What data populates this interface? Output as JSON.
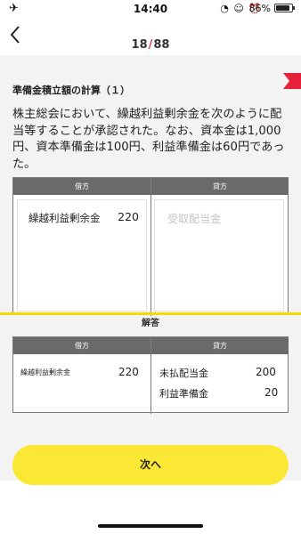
{
  "status_bar": {
    "time": "14:40",
    "icons": "◔ ☺ ⏰",
    "battery_percent": "86%",
    "battery_level": 0.86
  },
  "header": {
    "current": "18",
    "separator": "/",
    "total": "88"
  },
  "question": {
    "title": "準備金積立額の計算（１）",
    "text": "株主総会において、繰越利益剰余金を次のように配当等することが承認された。なお、資本金は1,000円、資本準備金は100円、利益準備金は60円であった。",
    "table": {
      "debit_header": "借方",
      "credit_header": "貸方",
      "debit_account": "繰越利益剰余金",
      "debit_amount": "220",
      "credit_placeholder": "受取配当金"
    }
  },
  "answer": {
    "label": "解答",
    "debit_header": "借方",
    "credit_header": "貸方",
    "debit_account": "繰越利益剰余金",
    "debit_amount": "220",
    "credit_rows": [
      {
        "account": "未払配当金",
        "amount": "200"
      },
      {
        "account": "利益準備金",
        "amount": "20"
      }
    ]
  },
  "next_button": {
    "label": "次へ"
  },
  "colors": {
    "accent_yellow": "#fbe834",
    "divider_yellow": "#f7d900",
    "counter_red": "#e0393e",
    "bookmark_red": "#e8213a",
    "table_header": "#6a6a6a"
  }
}
